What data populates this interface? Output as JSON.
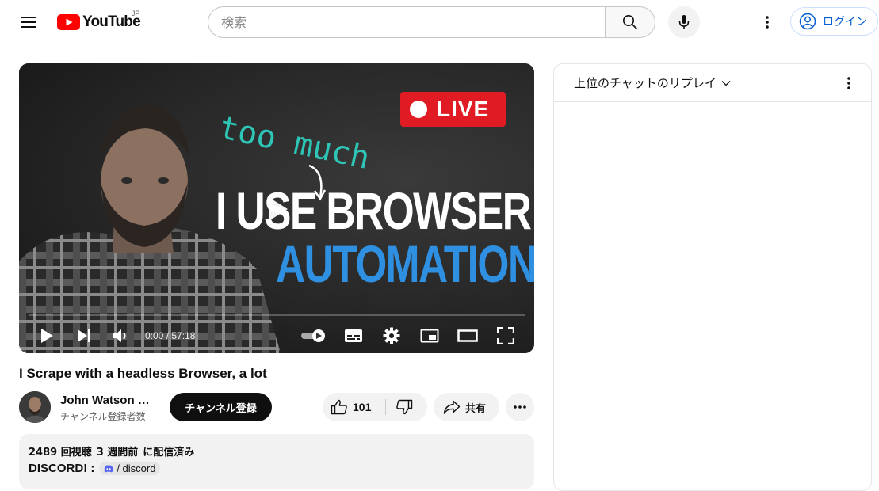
{
  "header": {
    "logo_text": "YouTube",
    "country_code": "JP",
    "search_placeholder": "検索",
    "login_label": "ログイン"
  },
  "player": {
    "thumbnail": {
      "live_badge": "LIVE",
      "handwritten": "too much",
      "line1": "I USE BROWSER",
      "line2": "AUTOMATION"
    },
    "time_display": "0:00 / 57:18",
    "progress": 0
  },
  "video": {
    "title": "I Scrape with a headless Browser, a lot",
    "channel_name": "John Watson Rooney",
    "subscribers": "チャンネル登録者数",
    "subscribe_label": "チャンネル登録",
    "like_count": "101",
    "share_label": "共有"
  },
  "description": {
    "views": "2489 回視聴",
    "date": "3 週間前",
    "status": "に配信済み",
    "first_line": "DISCORD! :",
    "discord_link": "/ discord"
  },
  "chat": {
    "title": "上位のチャットのリプレイ"
  },
  "colors": {
    "brand_red": "#ff0000",
    "link_blue": "#065fd4",
    "live_red": "#e01b24",
    "accent_teal": "#2ec4b6",
    "accent_blue": "#2f8fe0"
  }
}
